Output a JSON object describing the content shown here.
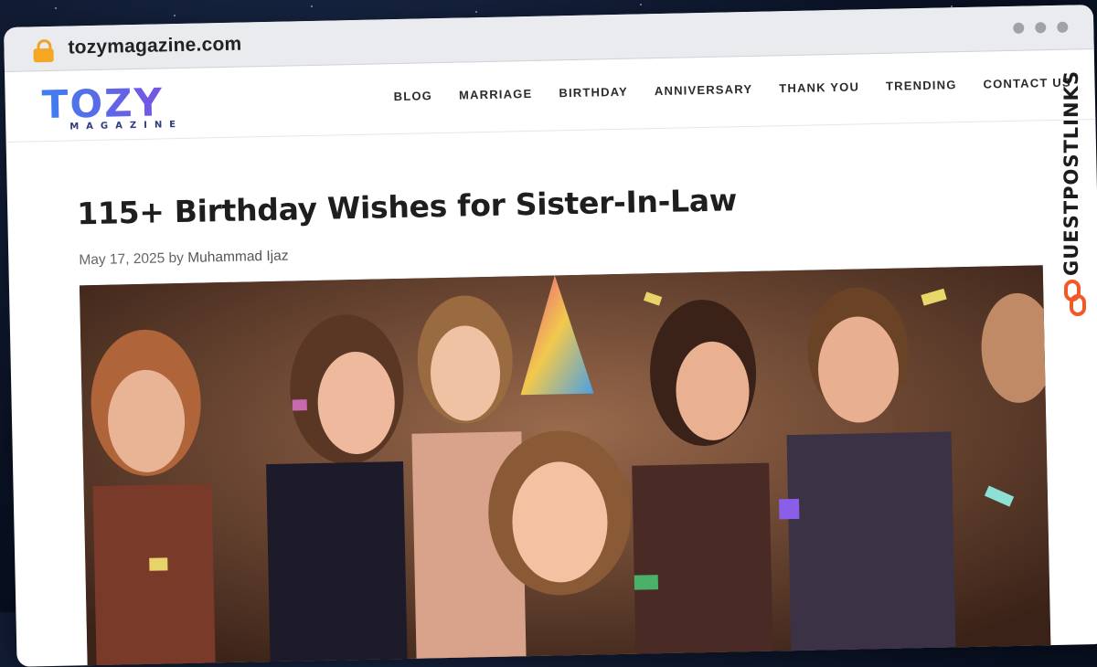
{
  "browser": {
    "url": "tozymagazine.com",
    "lock_icon": "lock-icon",
    "window_controls": [
      "dot",
      "dot",
      "dot"
    ]
  },
  "site": {
    "logo_text": "TOZY",
    "logo_subtext": "MAGAZINE",
    "nav": [
      "BLOG",
      "MARRIAGE",
      "BIRTHDAY",
      "ANNIVERSARY",
      "THANK YOU",
      "TRENDING",
      "CONTACT US"
    ]
  },
  "article": {
    "title": "115+ Birthday Wishes for Sister-In-Law",
    "date": "May 17, 2025",
    "by": "by",
    "author": "Muhammad Ijaz",
    "hero_image": "birthday-party-photo"
  },
  "banner": {
    "text": "GUESTPOSTLINKS",
    "icon": "chain-link-icon"
  },
  "colors": {
    "background": "#0b1428",
    "accent_orange": "#f05a28",
    "logo_blue": "#3f7ff0",
    "logo_purple": "#a34ee6"
  }
}
